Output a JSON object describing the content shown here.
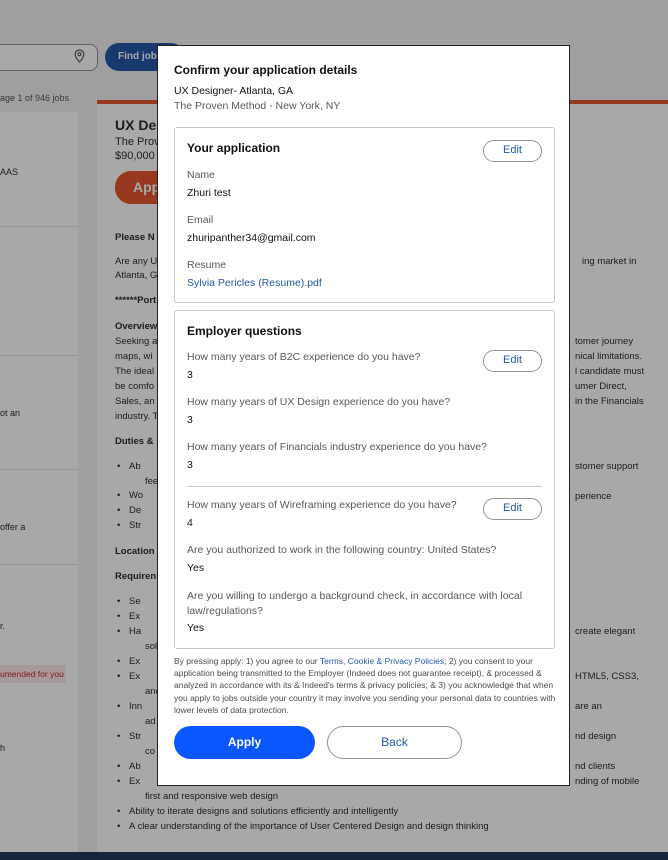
{
  "background": {
    "find_jobs_label": "Find jobs",
    "page_count": "age 1 of 946 jobs",
    "left_snippets": [
      "AAS",
      "ot an",
      "offer a",
      "r.",
      "h"
    ],
    "left_badge": "umended for you",
    "job_title": "UX Des",
    "job_company": "The Prov",
    "job_salary": "$90,000",
    "apply_fragment": "App",
    "lines": [
      "Please N",
      "Are any U",
      "Atlanta, G",
      "******Port",
      "Overview",
      "Seeking a",
      "maps, wi",
      "The ideal",
      "be comfo",
      "Sales, an",
      "industry. T",
      "Duties &",
      "Location",
      "Requiren"
    ],
    "duty_bullets": [
      "Ab",
      "fee",
      "Wo",
      "De",
      "Str"
    ],
    "req_bullets": [
      "Se",
      "Ex",
      "Ha",
      "sol",
      "Ex",
      "Ex",
      "and",
      "Inn",
      "ad",
      "Str",
      "co",
      "Ab",
      "Ex"
    ],
    "right_snippets": [
      "ing market in",
      "tomer journey",
      "nical limitations.",
      "l candidate must",
      "umer Direct,",
      "in the Financials",
      "stomer support",
      "perience",
      "create elegant",
      "HTML5, CSS3,",
      "are an",
      "nd design",
      "nd clients",
      "nding of mobile"
    ],
    "bottom_lines": [
      "first and responsive web design",
      "Ability to iterate designs and solutions efficiently and intelligently",
      "A clear understanding of the importance of User Centered Design and design thinking"
    ]
  },
  "modal": {
    "title": "Confirm your application details",
    "job_line": "UX Designer- Atlanta, GA",
    "company_line": "The Proven Method - New York, NY",
    "your_application": {
      "heading": "Your application",
      "edit_label": "Edit",
      "name_label": "Name",
      "name_value": "Zhuri test",
      "email_label": "Email",
      "email_value": "zhuripanther34@gmail.com",
      "resume_label": "Resume",
      "resume_value": "Sylvia Pericles (Resume).pdf"
    },
    "employer_questions": {
      "heading": "Employer questions",
      "edit_label": "Edit",
      "questions": [
        {
          "q": "How many years of B2C experience do you have?",
          "a": "3"
        },
        {
          "q": "How many years of UX Design experience do you have?",
          "a": "3"
        },
        {
          "q": "How many years of Financials industry experience do you have?",
          "a": "3"
        },
        {
          "q": "How many years of Wireframing experience do you have?",
          "a": "4"
        },
        {
          "q": "Are you authorized to work in the following country: United States?",
          "a": "Yes"
        },
        {
          "q": "Are you willing to undergo a background check, in accordance with local law/regulations?",
          "a": "Yes"
        }
      ]
    },
    "legal": {
      "before_link": "By pressing apply: 1) you agree to our ",
      "link_text": "Terms, Cookie & Privacy Policies",
      "after_link": "; 2) you consent to your application being transmitted to the Employer (Indeed does not guarantee receipt), & processed & analyzed in accordance with its & Indeed's terms & privacy policies; & 3) you acknowledge that when you apply to jobs outside your country it may involve you sending your personal data to countries with lower levels of data protection."
    },
    "apply_label": "Apply",
    "back_label": "Back"
  }
}
